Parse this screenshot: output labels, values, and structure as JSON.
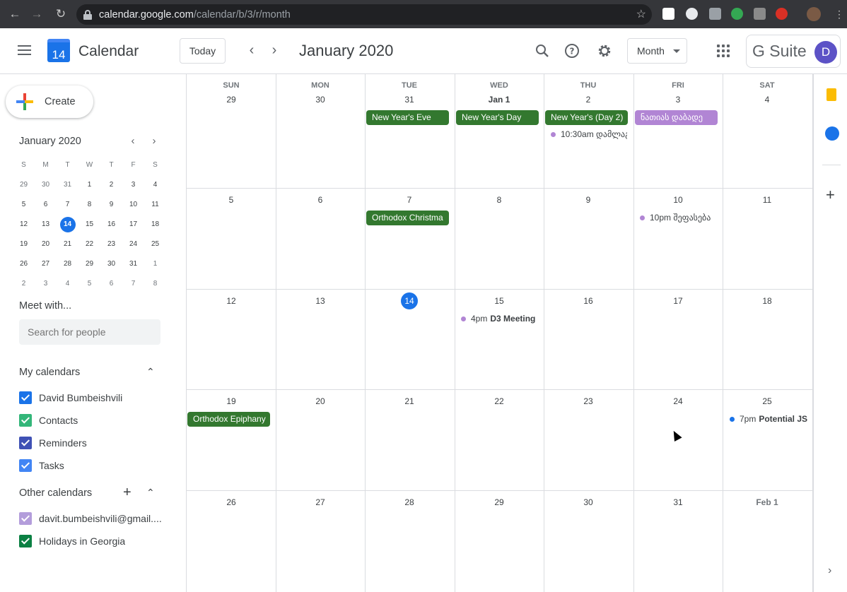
{
  "browser": {
    "url_host": "calendar.google.com",
    "url_path": "/calendar/b/3/r/month"
  },
  "header": {
    "app_title": "Calendar",
    "logo_day": "14",
    "today_label": "Today",
    "month_title": "January 2020",
    "view_label": "Month",
    "brand": "G Suite",
    "avatar_initial": "D"
  },
  "sidebar": {
    "create_label": "Create",
    "mini": {
      "title": "January 2020",
      "weekdays": [
        "S",
        "M",
        "T",
        "W",
        "T",
        "F",
        "S"
      ],
      "weeks": [
        [
          "29",
          "30",
          "31",
          "1",
          "2",
          "3",
          "4"
        ],
        [
          "5",
          "6",
          "7",
          "8",
          "9",
          "10",
          "11"
        ],
        [
          "12",
          "13",
          "14",
          "15",
          "16",
          "17",
          "18"
        ],
        [
          "19",
          "20",
          "21",
          "22",
          "23",
          "24",
          "25"
        ],
        [
          "26",
          "27",
          "28",
          "29",
          "30",
          "31",
          "1"
        ],
        [
          "2",
          "3",
          "4",
          "5",
          "6",
          "7",
          "8"
        ]
      ]
    },
    "meet_title": "Meet with...",
    "search_placeholder": "Search for people",
    "my_calendars_title": "My calendars",
    "my_calendars": [
      {
        "name": "David Bumbeishvili",
        "color": "#1a73e8"
      },
      {
        "name": "Contacts",
        "color": "#33b679"
      },
      {
        "name": "Reminders",
        "color": "#3f51b5"
      },
      {
        "name": "Tasks",
        "color": "#4285f4"
      }
    ],
    "other_calendars_title": "Other calendars",
    "other_calendars": [
      {
        "name": "davit.bumbeishvili@gmail....",
        "color": "#b39ddb"
      },
      {
        "name": "Holidays in Georgia",
        "color": "#0b8043"
      }
    ]
  },
  "month": {
    "weekdays": [
      "SUN",
      "MON",
      "TUE",
      "WED",
      "THU",
      "FRI",
      "SAT"
    ],
    "weeks": [
      [
        "29",
        "30",
        "31",
        "Jan 1",
        "2",
        "3",
        "4"
      ],
      [
        "5",
        "6",
        "7",
        "8",
        "9",
        "10",
        "11"
      ],
      [
        "12",
        "13",
        "14",
        "15",
        "16",
        "17",
        "18"
      ],
      [
        "19",
        "20",
        "21",
        "22",
        "23",
        "24",
        "25"
      ],
      [
        "26",
        "27",
        "28",
        "29",
        "30",
        "31",
        "Feb 1"
      ]
    ],
    "events": {
      "new_years_eve": "New Year's Eve",
      "new_years_day": "New Year's Day",
      "new_years_day2": "New Year's (Day 2)",
      "georgian_event": "ნათიას დაბადე",
      "thu_timed_time": "10:30am",
      "thu_timed_title": "დამლაგ",
      "orthodox_christmas": "Orthodox Christma",
      "fri10_time": "10pm",
      "fri10_title": "შეფასება",
      "d3_time": "4pm",
      "d3_title": "D3 Meeting",
      "epiphany": "Orthodox Epiphany",
      "js_time": "7pm",
      "js_title": "Potential JS"
    },
    "colors": {
      "holiday": "#33782f",
      "purple": "#b185d4",
      "blue": "#1a73e8"
    }
  }
}
